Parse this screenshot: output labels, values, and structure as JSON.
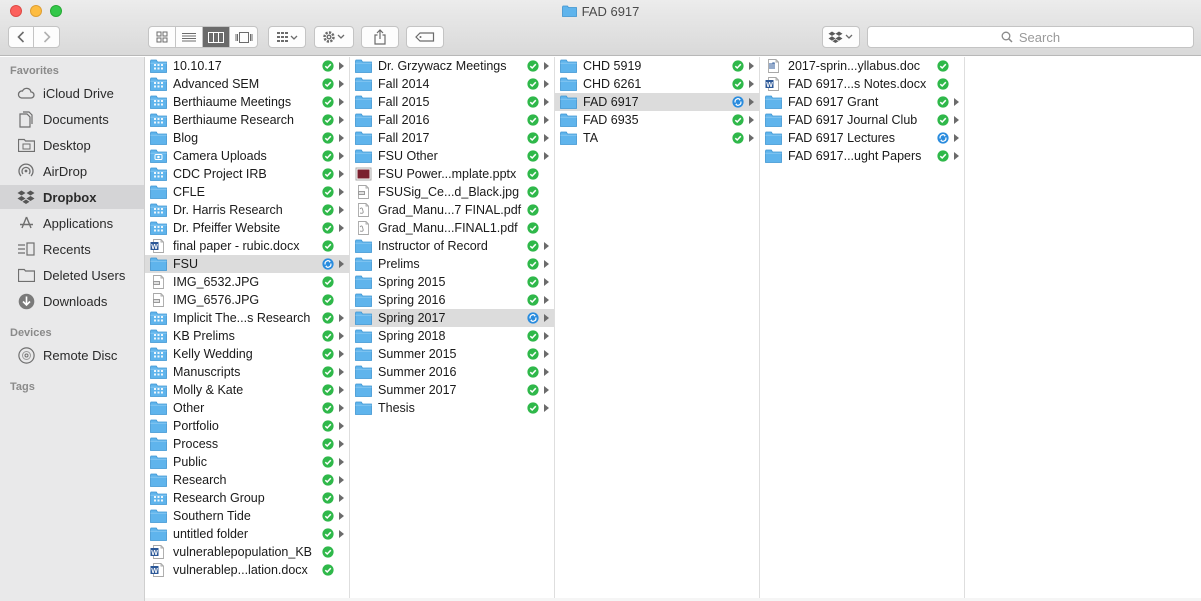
{
  "window": {
    "title": "FAD 6917"
  },
  "toolbar": {
    "search_placeholder": "Search"
  },
  "sidebar": {
    "favorites_label": "Favorites",
    "devices_label": "Devices",
    "tags_label": "Tags",
    "favorites": [
      {
        "label": "iCloud Drive",
        "icon": "cloud-icon"
      },
      {
        "label": "Documents",
        "icon": "documents-icon"
      },
      {
        "label": "Desktop",
        "icon": "desktop-icon"
      },
      {
        "label": "AirDrop",
        "icon": "airdrop-icon"
      },
      {
        "label": "Dropbox",
        "icon": "dropbox-icon",
        "selected": true
      },
      {
        "label": "Applications",
        "icon": "applications-icon"
      },
      {
        "label": "Recents",
        "icon": "recents-icon"
      },
      {
        "label": "Deleted Users",
        "icon": "folder-icon"
      },
      {
        "label": "Downloads",
        "icon": "downloads-icon"
      }
    ],
    "devices": [
      {
        "label": "Remote Disc",
        "icon": "disc-icon"
      }
    ]
  },
  "colors": {
    "folder": "#5fb4ec",
    "synced": "#2fb84a",
    "syncing": "#2a8cde",
    "selection": "#dcdcdc"
  },
  "columns": [
    {
      "items": [
        {
          "name": "10.10.17",
          "type": "folder-grid",
          "status": "synced",
          "arrow": true
        },
        {
          "name": "Advanced SEM",
          "type": "folder-grid",
          "status": "synced",
          "arrow": true
        },
        {
          "name": "Berthiaume Meetings",
          "type": "folder-grid",
          "status": "synced",
          "arrow": true
        },
        {
          "name": "Berthiaume Research",
          "type": "folder-grid",
          "status": "synced",
          "arrow": true
        },
        {
          "name": "Blog",
          "type": "folder",
          "status": "synced",
          "arrow": true
        },
        {
          "name": "Camera Uploads",
          "type": "folder-camera",
          "status": "synced",
          "arrow": true
        },
        {
          "name": "CDC Project IRB",
          "type": "folder-grid",
          "status": "synced",
          "arrow": true
        },
        {
          "name": "CFLE",
          "type": "folder",
          "status": "synced",
          "arrow": true
        },
        {
          "name": "Dr. Harris Research",
          "type": "folder-grid",
          "status": "synced",
          "arrow": true
        },
        {
          "name": "Dr. Pfeiffer Website",
          "type": "folder-grid",
          "status": "synced",
          "arrow": true
        },
        {
          "name": "final paper - rubic.docx",
          "type": "word",
          "status": "synced",
          "arrow": false
        },
        {
          "name": "FSU",
          "type": "folder",
          "status": "syncing",
          "arrow": true,
          "selected": true
        },
        {
          "name": "IMG_6532.JPG",
          "type": "image",
          "status": "synced",
          "arrow": false
        },
        {
          "name": "IMG_6576.JPG",
          "type": "image",
          "status": "synced",
          "arrow": false
        },
        {
          "name": "Implicit The...s Research",
          "type": "folder-grid",
          "status": "synced",
          "arrow": true
        },
        {
          "name": "KB Prelims",
          "type": "folder-grid",
          "status": "synced",
          "arrow": true
        },
        {
          "name": "Kelly Wedding",
          "type": "folder-grid",
          "status": "synced",
          "arrow": true
        },
        {
          "name": "Manuscripts",
          "type": "folder-grid",
          "status": "synced",
          "arrow": true
        },
        {
          "name": "Molly & Kate",
          "type": "folder-grid",
          "status": "synced",
          "arrow": true
        },
        {
          "name": "Other",
          "type": "folder",
          "status": "synced",
          "arrow": true
        },
        {
          "name": "Portfolio",
          "type": "folder",
          "status": "synced",
          "arrow": true
        },
        {
          "name": "Process",
          "type": "folder",
          "status": "synced",
          "arrow": true
        },
        {
          "name": "Public",
          "type": "folder",
          "status": "synced",
          "arrow": true
        },
        {
          "name": "Research",
          "type": "folder",
          "status": "synced",
          "arrow": true
        },
        {
          "name": "Research Group",
          "type": "folder-grid",
          "status": "synced",
          "arrow": true
        },
        {
          "name": "Southern Tide",
          "type": "folder",
          "status": "synced",
          "arrow": true
        },
        {
          "name": "untitled folder",
          "type": "folder",
          "status": "synced",
          "arrow": true
        },
        {
          "name": "vulnerablepopulation_KB",
          "type": "word",
          "status": "synced",
          "arrow": false
        },
        {
          "name": "vulnerablep...lation.docx",
          "type": "word",
          "status": "synced",
          "arrow": false
        }
      ]
    },
    {
      "items": [
        {
          "name": "Dr. Grzywacz Meetings",
          "type": "folder",
          "status": "synced",
          "arrow": true
        },
        {
          "name": "Fall 2014",
          "type": "folder",
          "status": "synced",
          "arrow": true
        },
        {
          "name": "Fall 2015",
          "type": "folder",
          "status": "synced",
          "arrow": true
        },
        {
          "name": "Fall 2016",
          "type": "folder",
          "status": "synced",
          "arrow": true
        },
        {
          "name": "Fall 2017",
          "type": "folder",
          "status": "synced",
          "arrow": true
        },
        {
          "name": "FSU Other",
          "type": "folder",
          "status": "synced",
          "arrow": true
        },
        {
          "name": "FSU Power...mplate.pptx",
          "type": "pptx",
          "status": "synced",
          "arrow": false
        },
        {
          "name": "FSUSig_Ce...d_Black.jpg",
          "type": "image",
          "status": "synced",
          "arrow": false
        },
        {
          "name": "Grad_Manu...7 FINAL.pdf",
          "type": "pdf",
          "status": "synced",
          "arrow": false
        },
        {
          "name": "Grad_Manu...FINAL1.pdf",
          "type": "pdf",
          "status": "synced",
          "arrow": false
        },
        {
          "name": "Instructor of Record",
          "type": "folder",
          "status": "synced",
          "arrow": true
        },
        {
          "name": "Prelims",
          "type": "folder",
          "status": "synced",
          "arrow": true
        },
        {
          "name": "Spring 2015",
          "type": "folder",
          "status": "synced",
          "arrow": true
        },
        {
          "name": "Spring 2016",
          "type": "folder",
          "status": "synced",
          "arrow": true
        },
        {
          "name": "Spring 2017",
          "type": "folder",
          "status": "syncing",
          "arrow": true,
          "selected": true
        },
        {
          "name": "Spring 2018",
          "type": "folder",
          "status": "synced",
          "arrow": true
        },
        {
          "name": "Summer 2015",
          "type": "folder",
          "status": "synced",
          "arrow": true
        },
        {
          "name": "Summer 2016",
          "type": "folder",
          "status": "synced",
          "arrow": true
        },
        {
          "name": "Summer 2017",
          "type": "folder",
          "status": "synced",
          "arrow": true
        },
        {
          "name": "Thesis",
          "type": "folder",
          "status": "synced",
          "arrow": true
        }
      ]
    },
    {
      "items": [
        {
          "name": "CHD 5919",
          "type": "folder",
          "status": "synced",
          "arrow": true
        },
        {
          "name": "CHD 6261",
          "type": "folder",
          "status": "synced",
          "arrow": true
        },
        {
          "name": "FAD 6917",
          "type": "folder",
          "status": "syncing",
          "arrow": true,
          "selected": true
        },
        {
          "name": "FAD 6935",
          "type": "folder",
          "status": "synced",
          "arrow": true
        },
        {
          "name": "TA",
          "type": "folder",
          "status": "synced",
          "arrow": true
        }
      ]
    },
    {
      "items": [
        {
          "name": "2017-sprin...yllabus.doc",
          "type": "word-doc",
          "status": "synced",
          "arrow": false
        },
        {
          "name": "FAD 6917...s Notes.docx",
          "type": "word",
          "status": "synced",
          "arrow": false
        },
        {
          "name": "FAD 6917 Grant",
          "type": "folder",
          "status": "synced",
          "arrow": true
        },
        {
          "name": "FAD 6917 Journal Club",
          "type": "folder",
          "status": "synced",
          "arrow": true
        },
        {
          "name": "FAD 6917 Lectures",
          "type": "folder",
          "status": "syncing",
          "arrow": true
        },
        {
          "name": "FAD 6917...ught Papers",
          "type": "folder",
          "status": "synced",
          "arrow": true
        }
      ]
    }
  ]
}
